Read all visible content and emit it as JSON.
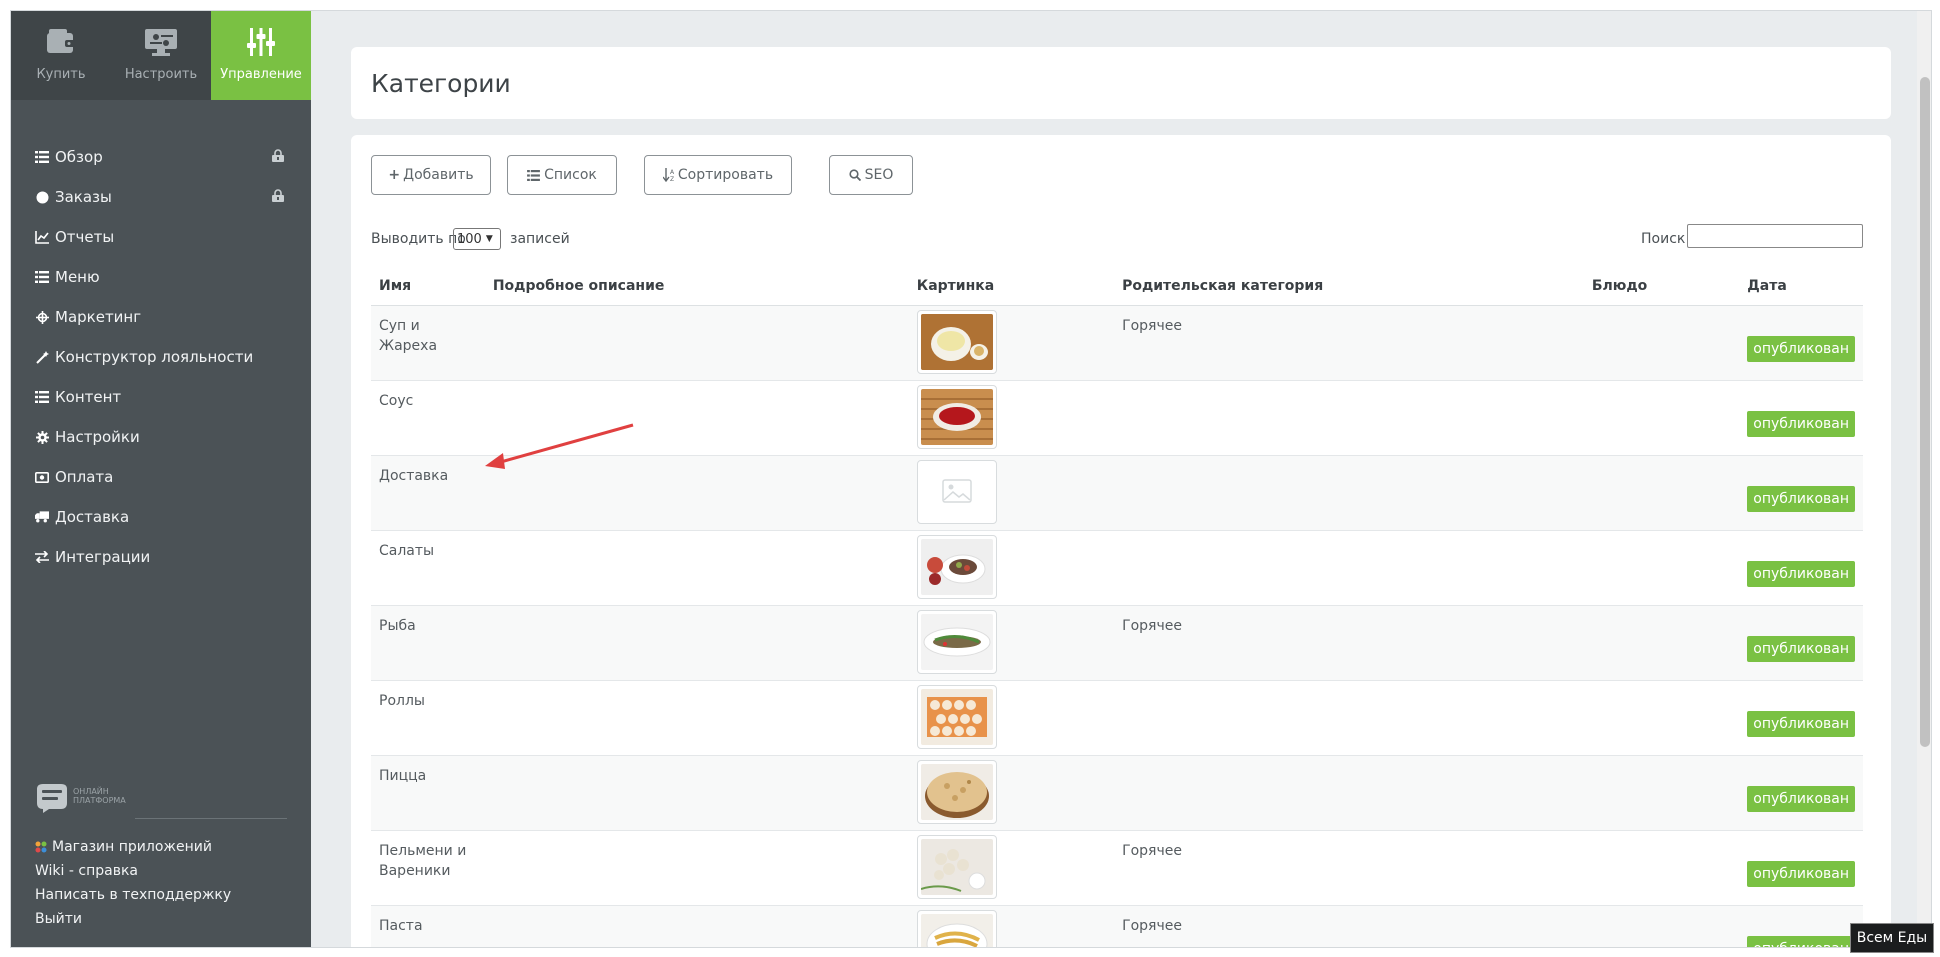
{
  "topnav": [
    {
      "label": "Купить",
      "icon": "wallet-icon",
      "active": false
    },
    {
      "label": "Настроить",
      "icon": "monitor-settings-icon",
      "active": false
    },
    {
      "label": "Управление",
      "icon": "sliders-icon",
      "active": true
    }
  ],
  "menu": [
    {
      "label": "Обзор",
      "icon": "list-icon",
      "locked": true
    },
    {
      "label": "Заказы",
      "icon": "circle-icon",
      "locked": true
    },
    {
      "label": "Отчеты",
      "icon": "chart-icon",
      "locked": false
    },
    {
      "label": "Меню",
      "icon": "list-icon",
      "locked": false
    },
    {
      "label": "Маркетинг",
      "icon": "crosshair-icon",
      "locked": false
    },
    {
      "label": "Конструктор лояльности",
      "icon": "wand-icon",
      "locked": false
    },
    {
      "label": "Контент",
      "icon": "list-icon",
      "locked": false
    },
    {
      "label": "Настройки",
      "icon": "gear-icon",
      "locked": false
    },
    {
      "label": "Оплата",
      "icon": "money-icon",
      "locked": false
    },
    {
      "label": "Доставка",
      "icon": "truck-icon",
      "locked": false
    },
    {
      "label": "Интеграции",
      "icon": "exchange-icon",
      "locked": false
    }
  ],
  "logo": {
    "title": "Всем Еды",
    "subtitle_line1": "ОНЛАЙН",
    "subtitle_line2": "ПЛАТФОРМА"
  },
  "bottom_links": [
    "Магазин приложений",
    "Wiki - справка",
    "Написать в техподдержку",
    "Выйти"
  ],
  "page_title": "Категории",
  "toolbar": {
    "add": "Добавить",
    "list": "Список",
    "sort": "Сортировать",
    "seo": "SEO"
  },
  "controls": {
    "show_prefix": "Выводить по",
    "page_size": "100",
    "show_suffix": "записей",
    "search_label": "Поиск:"
  },
  "table": {
    "headers": [
      "Имя",
      "Подробное описание",
      "Картинка",
      "Родительская категория",
      "Блюдо",
      "Дата"
    ],
    "rows": [
      {
        "name": "Суп и Жареха",
        "description": "",
        "image": "soup",
        "parent": "Горячее",
        "dish": "",
        "status": "опубликован"
      },
      {
        "name": "Соус",
        "description": "",
        "image": "sauce",
        "parent": "",
        "dish": "",
        "status": "опубликован"
      },
      {
        "name": "Доставка",
        "description": "",
        "image": "placeholder",
        "parent": "",
        "dish": "",
        "status": "опубликован"
      },
      {
        "name": "Салаты",
        "description": "",
        "image": "salad",
        "parent": "",
        "dish": "",
        "status": "опубликован"
      },
      {
        "name": "Рыба",
        "description": "",
        "image": "fish",
        "parent": "Горячее",
        "dish": "",
        "status": "опубликован"
      },
      {
        "name": "Роллы",
        "description": "",
        "image": "rolls",
        "parent": "",
        "dish": "",
        "status": "опубликован"
      },
      {
        "name": "Пицца",
        "description": "",
        "image": "pizza",
        "parent": "",
        "dish": "",
        "status": "опубликован"
      },
      {
        "name": "Пельмени и Вареники",
        "description": "",
        "image": "dumplings",
        "parent": "Горячее",
        "dish": "",
        "status": "опубликован"
      },
      {
        "name": "Паста",
        "description": "",
        "image": "pasta",
        "parent": "Горячее",
        "dish": "",
        "status": "опубликован"
      }
    ]
  },
  "corner_badge": "Всем Еды",
  "colors": {
    "accent": "#7ac143",
    "sidebar": "#4b5256",
    "sidebar_top": "#3f4548",
    "arrow": "#e04040"
  }
}
